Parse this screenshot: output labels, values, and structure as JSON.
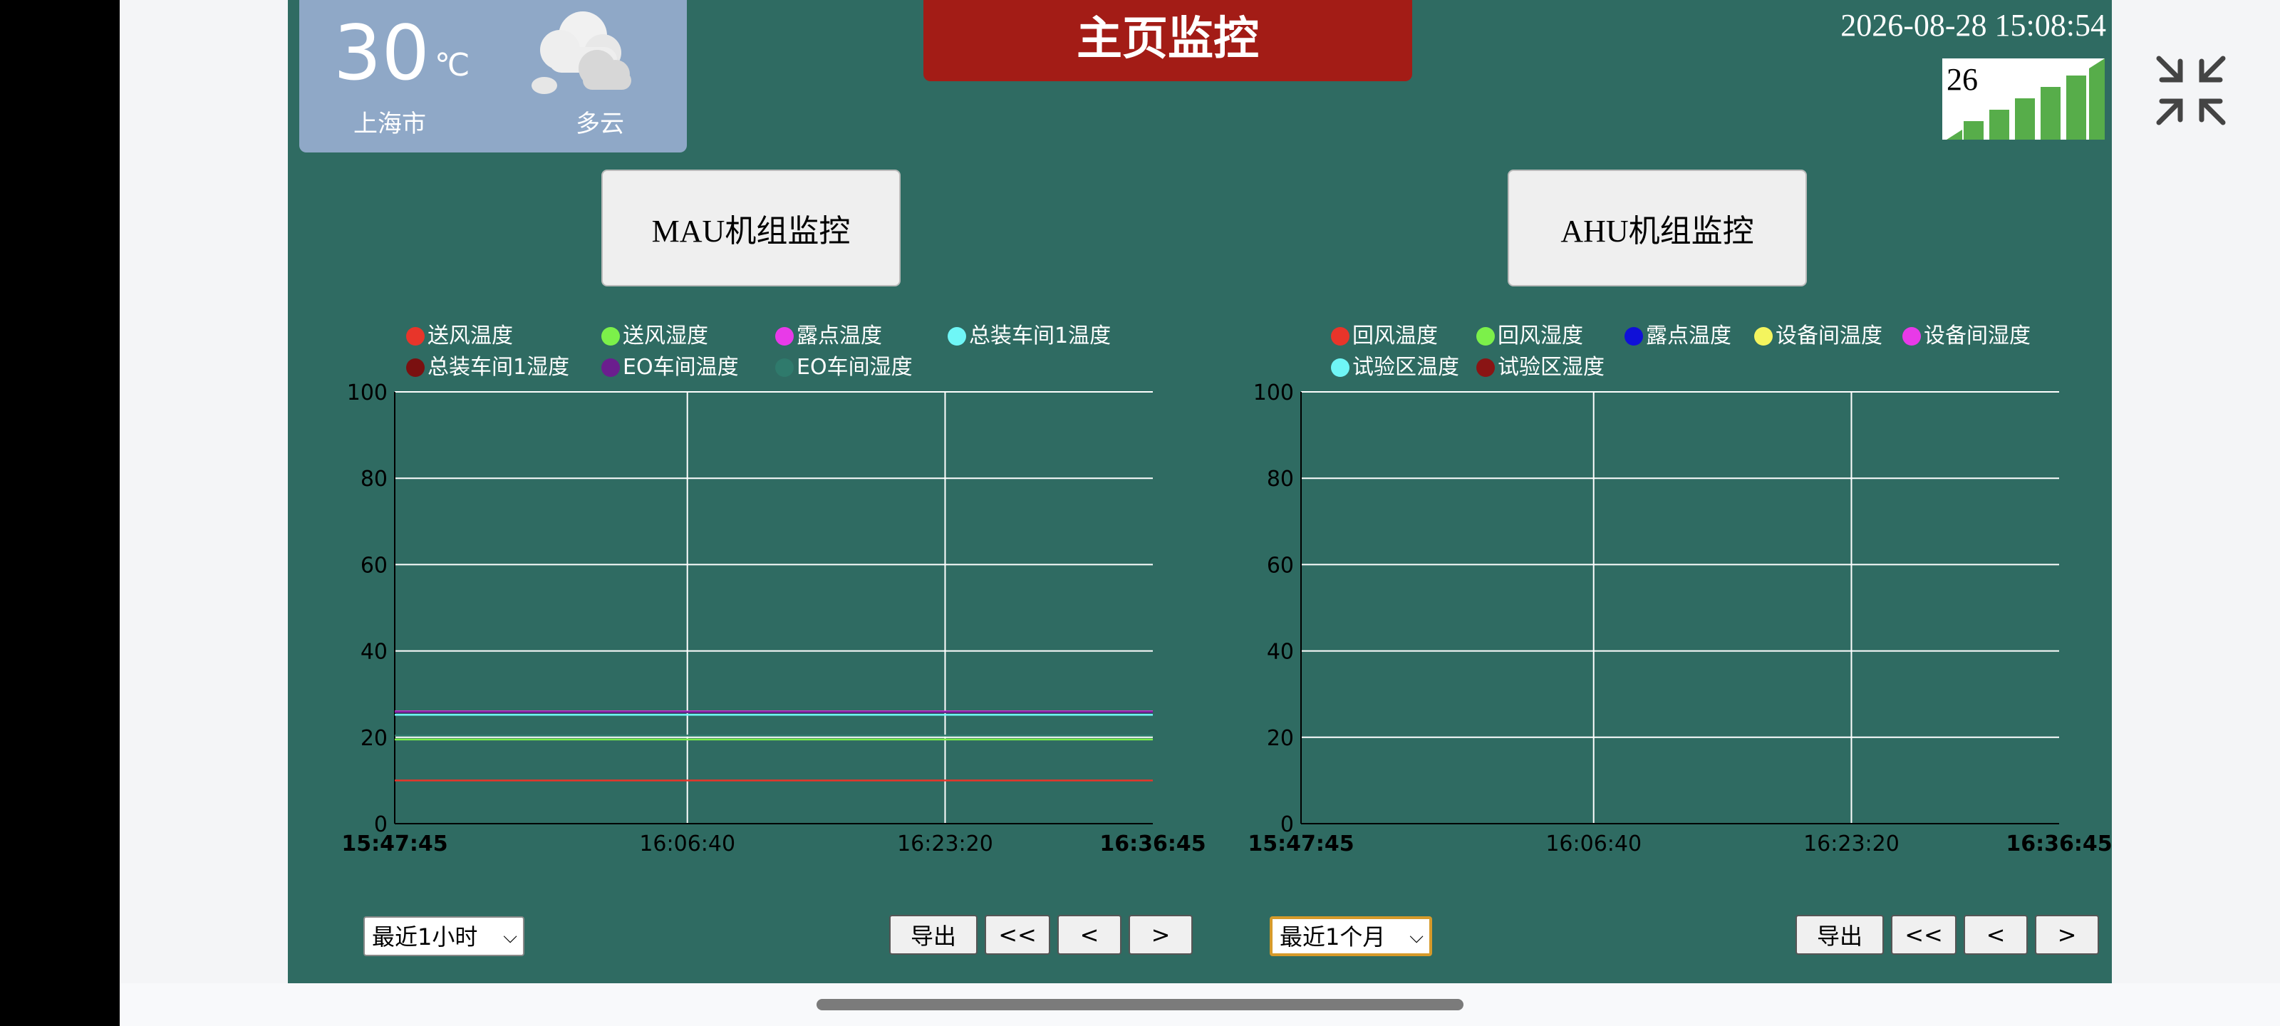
{
  "weather": {
    "temperature": "30",
    "unit": "℃",
    "city": "上海市",
    "condition": "多云",
    "icon": "cloud-icon"
  },
  "title": "主页监控",
  "datetime": "2026-08-28 15:08:54",
  "signal": {
    "value": "26"
  },
  "sections": [
    {
      "label": "MAU机组监控"
    },
    {
      "label": "AHU机组监控"
    }
  ],
  "mau_legend": [
    {
      "label": "送风温度",
      "color": "#e8352a"
    },
    {
      "label": "送风湿度",
      "color": "#7cf04a"
    },
    {
      "label": "露点温度",
      "color": "#e83ae8"
    },
    {
      "label": "总装车间1温度",
      "color": "#6ff6f6"
    },
    {
      "label": "总装车间1湿度",
      "color": "#7a1010"
    },
    {
      "label": "EO车间温度",
      "color": "#6b1e8e"
    },
    {
      "label": "EO车间湿度",
      "color": "#2f7a6c"
    }
  ],
  "ahu_legend": [
    {
      "label": "回风温度",
      "color": "#e8352a"
    },
    {
      "label": "回风湿度",
      "color": "#7cf04a"
    },
    {
      "label": "露点温度",
      "color": "#1010d8"
    },
    {
      "label": "设备间温度",
      "color": "#f4f45e"
    },
    {
      "label": "设备间湿度",
      "color": "#e83ae8"
    },
    {
      "label": "试验区温度",
      "color": "#6ff6f6"
    },
    {
      "label": "试验区湿度",
      "color": "#8a1414"
    }
  ],
  "controls": {
    "mau_range": "最近1小时",
    "ahu_range": "最近1个月",
    "export": "导出",
    "first": "<<",
    "prev": "<",
    "next": ">"
  },
  "chart_data": [
    {
      "type": "line",
      "ylim": [
        0,
        100
      ],
      "yticks": [
        "0",
        "20",
        "40",
        "60",
        "80",
        "100"
      ],
      "xticks": [
        {
          "label": "15:47:45",
          "pos": 0,
          "bold": true
        },
        {
          "label": "16:06:40",
          "pos": 0.386,
          "bold": false
        },
        {
          "label": "16:23:20",
          "pos": 0.726,
          "bold": false
        },
        {
          "label": "16:36:45",
          "pos": 1,
          "bold": true
        }
      ],
      "grid": true,
      "series": [
        {
          "name": "送风温度",
          "color": "#e8352a",
          "values": [
            10,
            10
          ]
        },
        {
          "name": "送风湿度",
          "color": "#7cf04a",
          "values": [
            19.5,
            19.5
          ]
        },
        {
          "name": "露点温度",
          "color": "#e83ae8",
          "values": [
            26,
            26
          ]
        },
        {
          "name": "总装车间1温度",
          "color": "#6ff6f6",
          "values": [
            25.2,
            25.2
          ]
        },
        {
          "name": "EO车间温度",
          "color": "#6b1e8e",
          "values": [
            25.8,
            25.8
          ]
        },
        {
          "name": "EO车间湿度",
          "color": "#2f7a6c",
          "values": [
            20.4,
            20.4
          ]
        }
      ]
    },
    {
      "type": "line",
      "ylim": [
        0,
        100
      ],
      "yticks": [
        "0",
        "20",
        "40",
        "60",
        "80",
        "100"
      ],
      "xticks": [
        {
          "label": "15:47:45",
          "pos": 0,
          "bold": true
        },
        {
          "label": "16:06:40",
          "pos": 0.386,
          "bold": false
        },
        {
          "label": "16:23:20",
          "pos": 0.726,
          "bold": false
        },
        {
          "label": "16:36:45",
          "pos": 1,
          "bold": true
        }
      ],
      "grid": true,
      "series": []
    }
  ]
}
